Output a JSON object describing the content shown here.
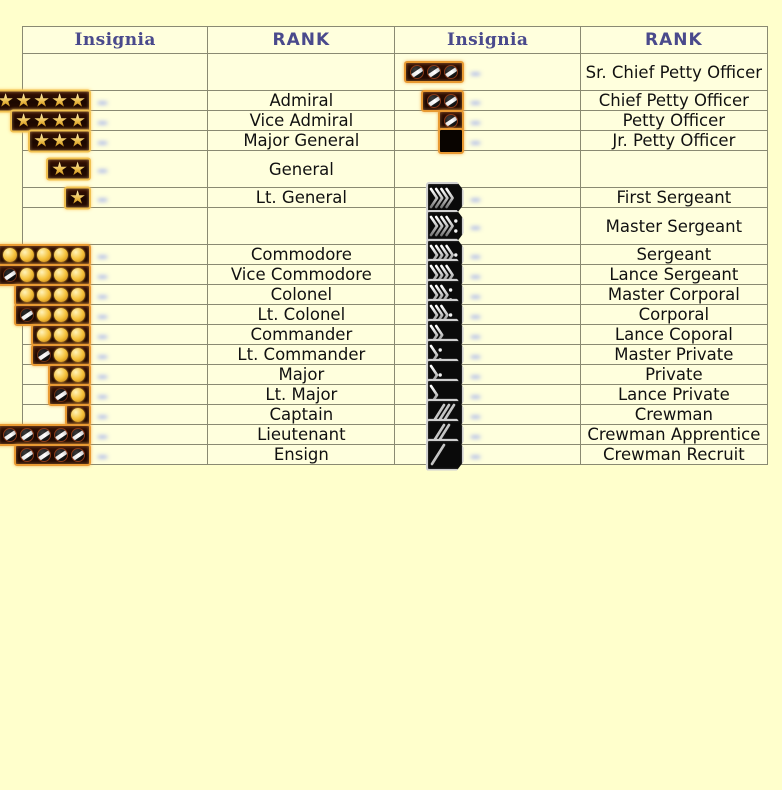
{
  "page": {
    "background_color": "#ffffcc",
    "cell_color": "#ffffdd",
    "blank_cell_color": "#adadad",
    "border_color": "#8a8a72",
    "header_text_color": "#4a4a8c",
    "body_text_color": "#111111"
  },
  "headers": {
    "insignia_left": "Insignia",
    "rank_left": "RANK",
    "insignia_right": "Insignia",
    "rank_right": "RANK"
  },
  "rows": [
    {
      "left": {
        "blank": true,
        "rank": "",
        "insignia": {
          "kind": "none"
        }
      },
      "right": {
        "blank": false,
        "rank": "Sr. Chief Petty Officer",
        "insignia": {
          "kind": "bar",
          "frame": "orange",
          "pips": [
            "silver",
            "silver",
            "silver"
          ]
        }
      }
    },
    {
      "left": {
        "blank": false,
        "rank": "Admiral",
        "insignia": {
          "kind": "bar",
          "frame": "gold",
          "stars": 5
        }
      },
      "right": {
        "blank": false,
        "rank": "Chief Petty Officer",
        "insignia": {
          "kind": "bar",
          "frame": "orange",
          "pips": [
            "silver",
            "silver"
          ]
        }
      }
    },
    {
      "left": {
        "blank": false,
        "rank": "Vice Admiral",
        "insignia": {
          "kind": "bar",
          "frame": "gold",
          "stars": 4
        }
      },
      "right": {
        "blank": false,
        "rank": "Petty Officer",
        "insignia": {
          "kind": "bar",
          "frame": "orange",
          "pips": [
            "silver"
          ]
        }
      }
    },
    {
      "left": {
        "blank": false,
        "rank": "Major General",
        "insignia": {
          "kind": "bar",
          "frame": "gold",
          "stars": 3
        }
      },
      "right": {
        "blank": false,
        "rank": "Jr. Petty Officer",
        "insignia": {
          "kind": "hollow",
          "frame": "orange"
        }
      }
    },
    {
      "left": {
        "blank": false,
        "rank": "General",
        "insignia": {
          "kind": "bar",
          "frame": "gold",
          "stars": 2
        }
      },
      "right": {
        "blank": true,
        "rank": "",
        "insignia": {
          "kind": "none"
        }
      }
    },
    {
      "left": {
        "blank": false,
        "rank": "Lt. General",
        "insignia": {
          "kind": "bar",
          "frame": "gold",
          "stars": 1
        }
      },
      "right": {
        "blank": false,
        "rank": "First Sergeant",
        "insignia": {
          "kind": "chevron",
          "chevrons": 4,
          "dots": 0
        }
      }
    },
    {
      "left": {
        "blank": true,
        "rank": "",
        "insignia": {
          "kind": "none"
        }
      },
      "right": {
        "blank": false,
        "rank": "Master Sergeant",
        "insignia": {
          "kind": "chevron",
          "chevrons": 4,
          "dots": 2
        }
      }
    },
    {
      "left": {
        "blank": false,
        "rank": "Commodore",
        "insignia": {
          "kind": "bar",
          "frame": "orange",
          "pips": [
            "gold",
            "gold",
            "gold",
            "gold",
            "gold"
          ]
        }
      },
      "right": {
        "blank": false,
        "rank": "Sergeant",
        "insignia": {
          "kind": "chevron",
          "chevrons": 4,
          "dots": 1
        }
      }
    },
    {
      "left": {
        "blank": false,
        "rank": "Vice Commodore",
        "insignia": {
          "kind": "bar",
          "frame": "orange",
          "pips": [
            "dark",
            "gold",
            "gold",
            "gold",
            "gold"
          ]
        }
      },
      "right": {
        "blank": false,
        "rank": "Lance Sergeant",
        "insignia": {
          "kind": "chevron",
          "chevrons": 4,
          "dots": 0
        }
      }
    },
    {
      "left": {
        "blank": false,
        "rank": "Colonel",
        "insignia": {
          "kind": "bar",
          "frame": "orange",
          "pips": [
            "gold",
            "gold",
            "gold",
            "gold"
          ]
        }
      },
      "right": {
        "blank": false,
        "rank": "Master Corporal",
        "insignia": {
          "kind": "chevron",
          "chevrons": 3,
          "dots": 2
        }
      }
    },
    {
      "left": {
        "blank": false,
        "rank": "Lt. Colonel",
        "insignia": {
          "kind": "bar",
          "frame": "orange",
          "pips": [
            "dark",
            "gold",
            "gold",
            "gold"
          ]
        }
      },
      "right": {
        "blank": false,
        "rank": "Corporal",
        "insignia": {
          "kind": "chevron",
          "chevrons": 3,
          "dots": 1
        }
      }
    },
    {
      "left": {
        "blank": false,
        "rank": "Commander",
        "insignia": {
          "kind": "bar",
          "frame": "orange",
          "pips": [
            "gold",
            "gold",
            "gold"
          ]
        }
      },
      "right": {
        "blank": false,
        "rank": "Lance Coporal",
        "insignia": {
          "kind": "chevron",
          "chevrons": 2,
          "dots": 0
        }
      }
    },
    {
      "left": {
        "blank": false,
        "rank": "Lt. Commander",
        "insignia": {
          "kind": "bar",
          "frame": "orange",
          "pips": [
            "dark",
            "gold",
            "gold"
          ]
        }
      },
      "right": {
        "blank": false,
        "rank": "Master Private",
        "insignia": {
          "kind": "chevron",
          "chevrons": 1,
          "dots": 2
        }
      }
    },
    {
      "left": {
        "blank": false,
        "rank": "Major",
        "insignia": {
          "kind": "bar",
          "frame": "orange",
          "pips": [
            "gold",
            "gold"
          ]
        }
      },
      "right": {
        "blank": false,
        "rank": "Private",
        "insignia": {
          "kind": "chevron",
          "chevrons": 1,
          "dots": 1
        }
      }
    },
    {
      "left": {
        "blank": false,
        "rank": "Lt. Major",
        "insignia": {
          "kind": "bar",
          "frame": "orange",
          "pips": [
            "dark",
            "gold"
          ]
        }
      },
      "right": {
        "blank": false,
        "rank": "Lance Private",
        "insignia": {
          "kind": "chevron",
          "chevrons": 1,
          "dots": 0
        }
      }
    },
    {
      "left": {
        "blank": false,
        "rank": "Captain",
        "insignia": {
          "kind": "bar",
          "frame": "orange",
          "pips": [
            "gold"
          ]
        }
      },
      "right": {
        "blank": false,
        "rank": "Crewman",
        "insignia": {
          "kind": "slash",
          "slashes": 3
        }
      }
    },
    {
      "left": {
        "blank": false,
        "rank": "Lieutenant",
        "insignia": {
          "kind": "bar",
          "frame": "orange",
          "pips": [
            "silver",
            "silver",
            "silver",
            "silver",
            "silver"
          ]
        }
      },
      "right": {
        "blank": false,
        "rank": "Crewman Apprentice",
        "insignia": {
          "kind": "slash",
          "slashes": 2
        }
      }
    },
    {
      "left": {
        "blank": false,
        "rank": "Ensign",
        "insignia": {
          "kind": "bar",
          "frame": "orange",
          "pips": [
            "silver",
            "silver",
            "silver",
            "silver"
          ]
        }
      },
      "right": {
        "blank": false,
        "rank": "Crewman Recruit",
        "insignia": {
          "kind": "slash",
          "slashes": 1
        }
      }
    }
  ]
}
